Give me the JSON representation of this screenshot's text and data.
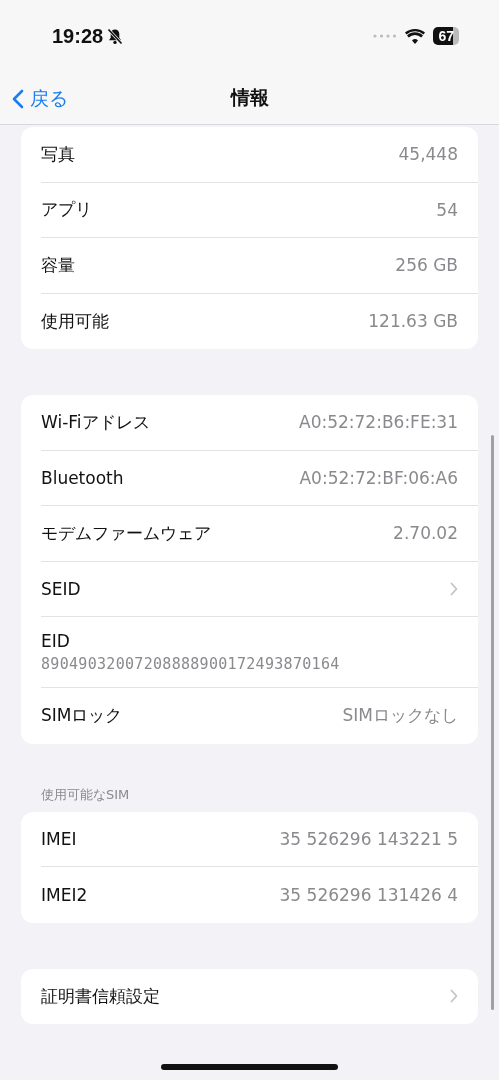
{
  "status_bar": {
    "time": "19:28",
    "battery": "67"
  },
  "nav_bar": {
    "back": "戻る",
    "title": "情報"
  },
  "groups": [
    {
      "rows": [
        {
          "kind": "value",
          "label": "写真",
          "value": "45,448"
        },
        {
          "kind": "value",
          "label": "アプリ",
          "value": "54"
        },
        {
          "kind": "value",
          "label": "容量",
          "value": "256 GB"
        },
        {
          "kind": "value",
          "label": "使用可能",
          "value": "121.63 GB"
        }
      ]
    },
    {
      "rows": [
        {
          "kind": "value",
          "label": "Wi-Fiアドレス",
          "value": "A0:52:72:B6:FE:31"
        },
        {
          "kind": "value",
          "label": "Bluetooth",
          "value": "A0:52:72:BF:06:A6"
        },
        {
          "kind": "value",
          "label": "モデムファームウェア",
          "value": "2.70.02"
        },
        {
          "kind": "chevron",
          "label": "SEID"
        },
        {
          "kind": "stacked",
          "label": "EID",
          "value": "89049032007208888900172493870164"
        },
        {
          "kind": "value",
          "label": "SIMロック",
          "value": "SIMロックなし"
        }
      ]
    },
    {
      "header": "使用可能なSIM",
      "rows": [
        {
          "kind": "value",
          "label": "IMEI",
          "value": "35 526296 143221 5"
        },
        {
          "kind": "value",
          "label": "IMEI2",
          "value": "35 526296 131426 4"
        }
      ]
    },
    {
      "rows": [
        {
          "kind": "chevron",
          "label": "証明書信頼設定"
        }
      ]
    }
  ]
}
